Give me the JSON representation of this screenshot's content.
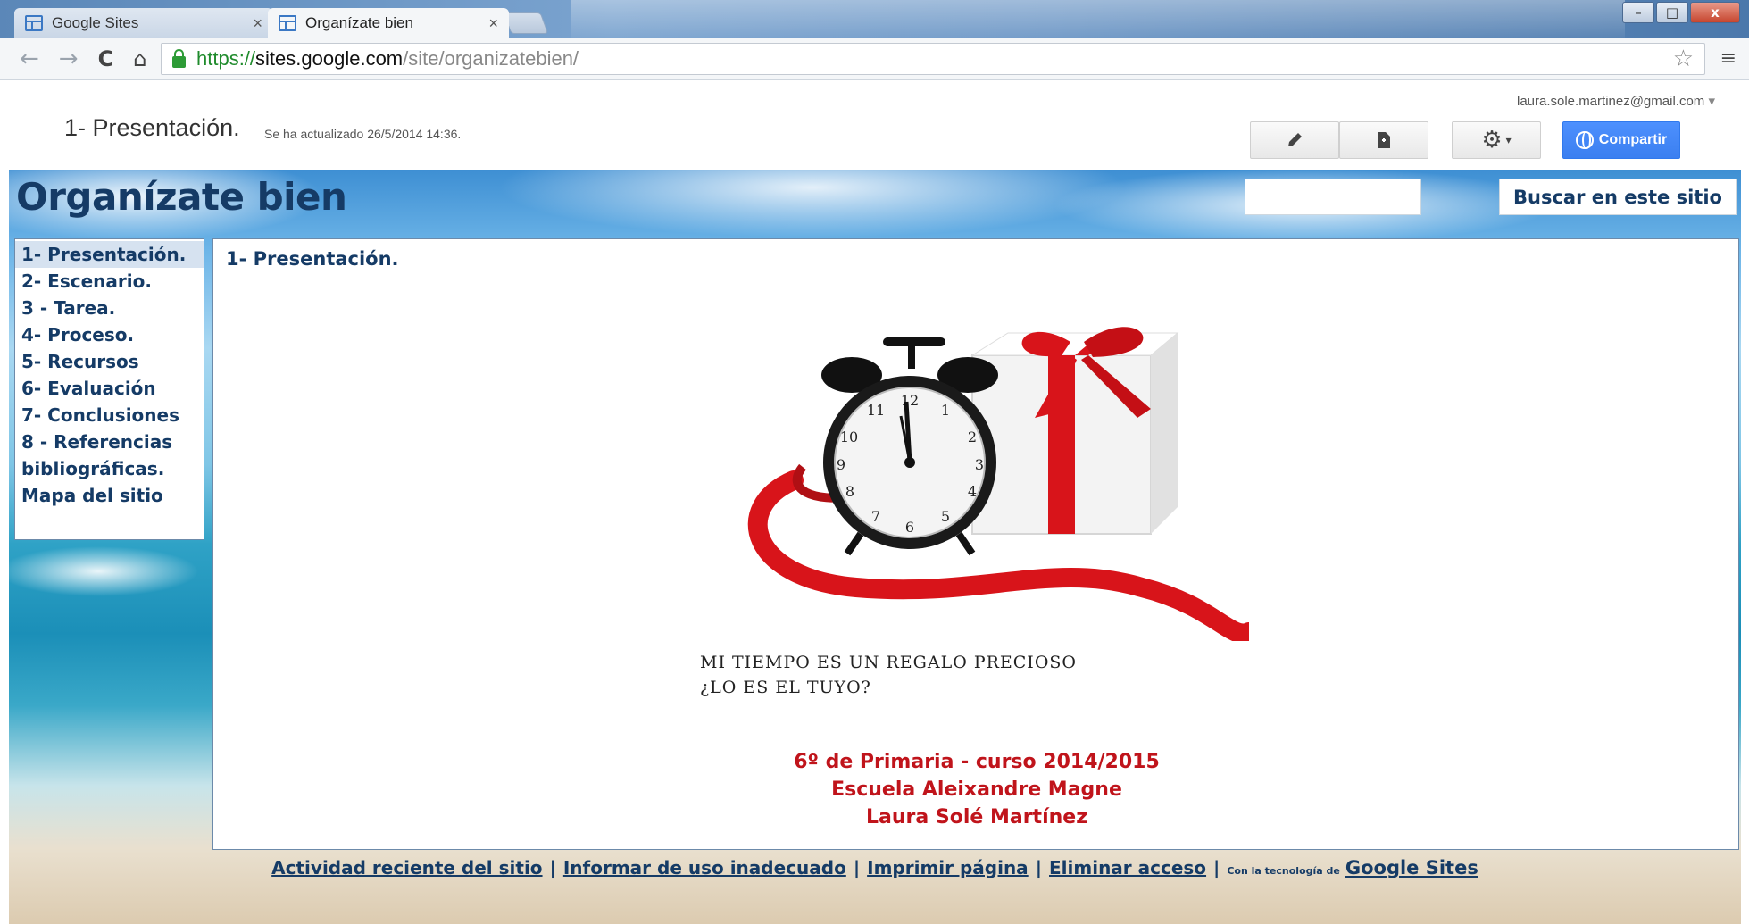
{
  "browser": {
    "tabs": [
      {
        "title": "Google Sites",
        "close": "×"
      },
      {
        "title": "Organízate bien",
        "close": "×"
      }
    ],
    "window_buttons": {
      "minimize": "–",
      "maximize": "□",
      "close": "x"
    },
    "url": {
      "scheme": "https://",
      "host": "sites.google.com",
      "path": "/site/organizatebien/"
    },
    "nav": {
      "back": "←",
      "forward": "→",
      "reload": "C",
      "home": "⌂",
      "star": "☆",
      "menu": "≡"
    }
  },
  "sites_header": {
    "account": "laura.sole.martinez@gmail.com",
    "page_title": "1- Presentación.",
    "updated": "Se ha actualizado 26/5/2014 14:36.",
    "edit_icon": "pencil-icon",
    "newpage_icon": "new-page-icon",
    "settings_icon": "gear-icon",
    "share_label": "Compartir"
  },
  "site": {
    "title": "Organízate bien",
    "search_button": "Buscar en este sitio",
    "nav": [
      {
        "label": "1- Presentación.",
        "current": true
      },
      {
        "label": "2- Escenario."
      },
      {
        "label": "3 - Tarea."
      },
      {
        "label": "4- Proceso."
      },
      {
        "label": "5- Recursos"
      },
      {
        "label": "6- Evaluación"
      },
      {
        "label": "7- Conclusiones"
      },
      {
        "label": "8 - Referencias bibliográficas."
      },
      {
        "label": "Mapa del sitio"
      }
    ],
    "content": {
      "heading": "1- Presentación.",
      "caption_line1": "MI TIEMPO ES UN REGALO PRECIOSO",
      "caption_line2": "¿LO ES EL TUYO?",
      "credit_line1": "6º de Primaria - curso 2014/2015",
      "credit_line2": "Escuela Aleixandre Magne",
      "credit_line3": "Laura Solé Martínez"
    },
    "footer": {
      "recent": "Actividad reciente del sitio",
      "report": "Informar de uso inadecuado",
      "print": "Imprimir página",
      "remove": "Eliminar acceso",
      "powered_by": "Con la tecnología de",
      "brand": "Google Sites",
      "separator": "|"
    }
  },
  "colors": {
    "site_text": "#153b66",
    "credits": "#c0141b",
    "share_button": "#4d90fe",
    "ribbon": "#d8141a"
  }
}
